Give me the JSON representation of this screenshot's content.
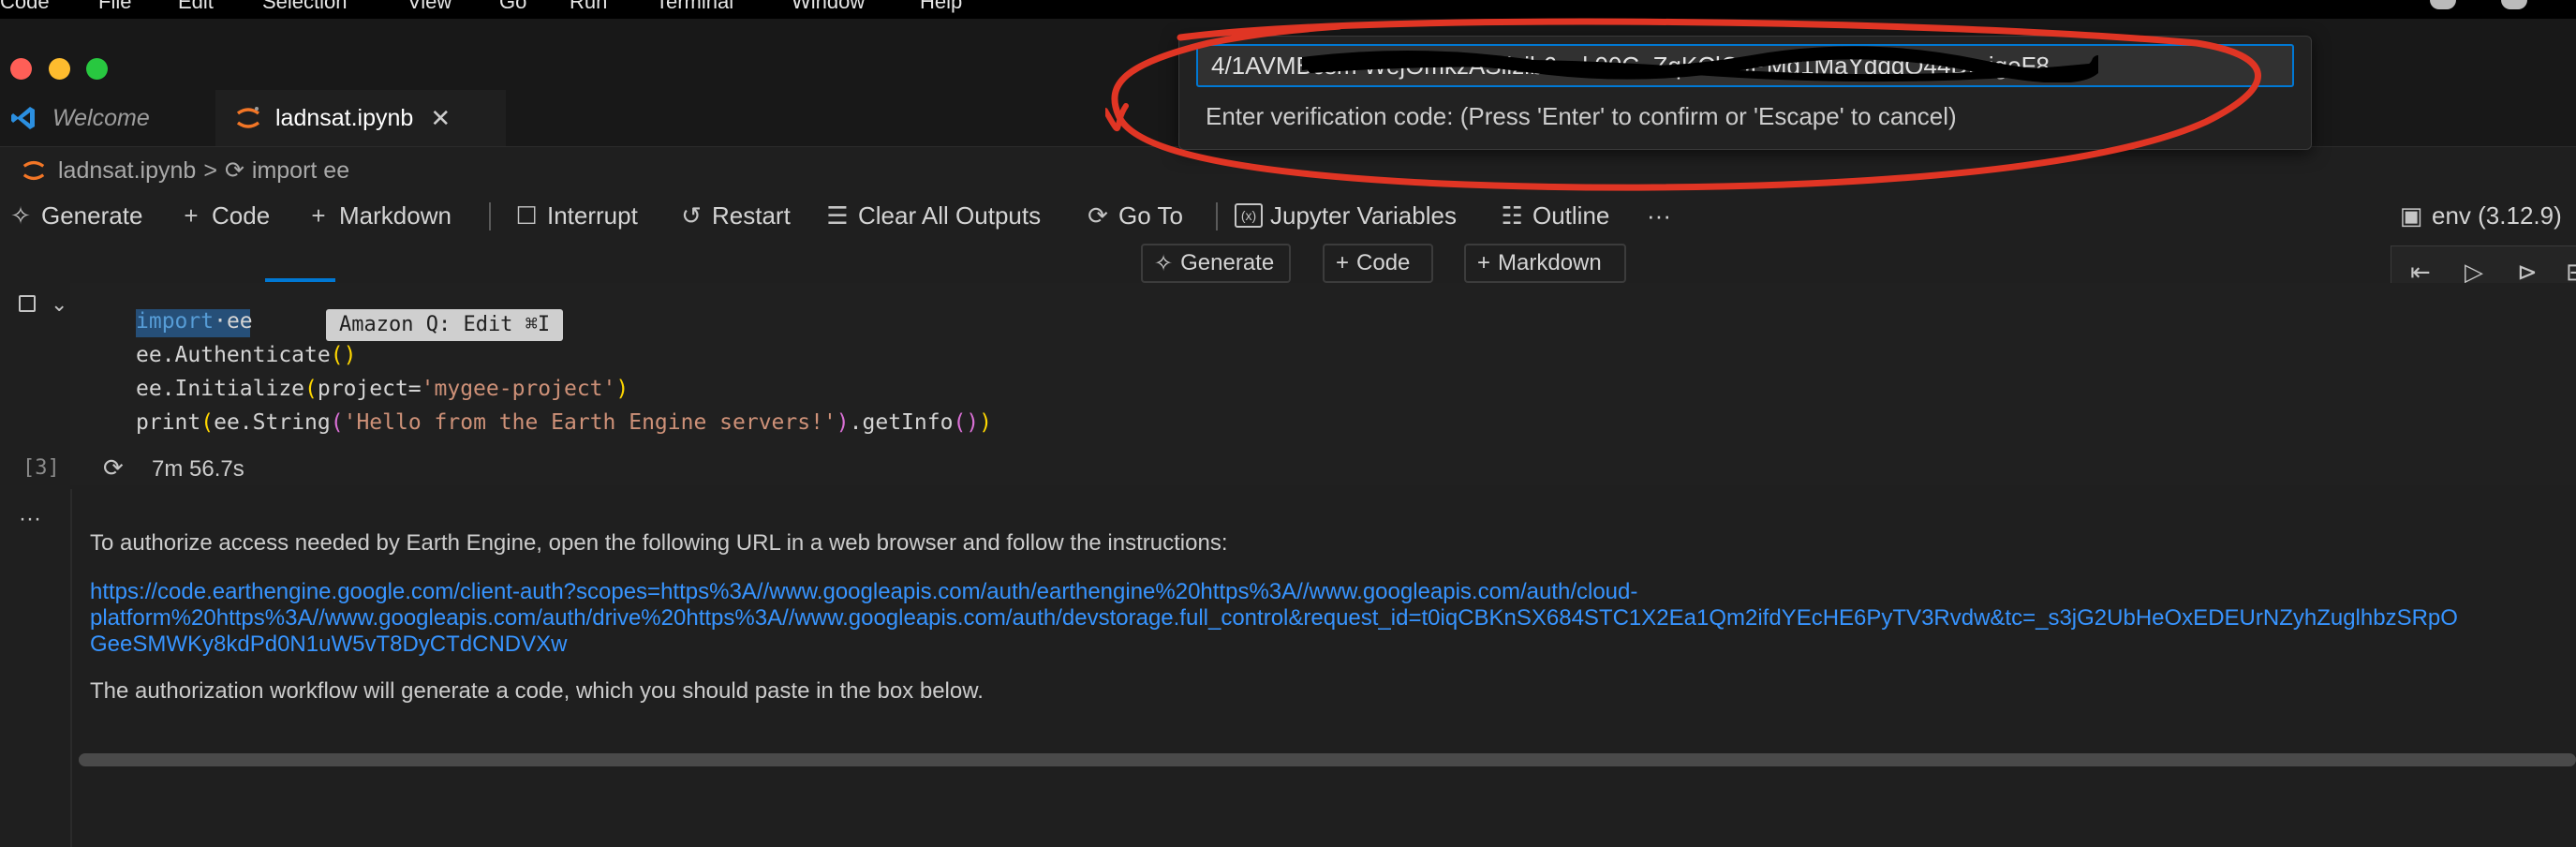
{
  "menubar": {
    "items": [
      "Code",
      "File",
      "Edit",
      "Selection",
      "View",
      "Go",
      "Run",
      "Terminal",
      "Window",
      "Help"
    ]
  },
  "tabs": [
    {
      "label": "Welcome",
      "active": false
    },
    {
      "label": "ladnsat.ipynb",
      "active": true
    }
  ],
  "breadcrumb": {
    "file": "ladnsat.ipynb",
    "separator": ">",
    "symbol": "import ee"
  },
  "toolbar": {
    "generate": "Generate",
    "code": "Code",
    "markdown": "Markdown",
    "interrupt": "Interrupt",
    "restart": "Restart",
    "clear_outputs": "Clear All Outputs",
    "goto": "Go To",
    "jupyter_variables": "Jupyter Variables",
    "outline": "Outline",
    "more": "···",
    "kernel": "env (3.12.9)"
  },
  "insert_bar": {
    "generate": "Generate",
    "code": "Code",
    "markdown": "Markdown"
  },
  "cell": {
    "code_lines": [
      "import ee",
      "ee.Authenticate()",
      "ee.Initialize(project='mygee-project')",
      "print(ee.String('Hello from the Earth Engine servers!').getInfo())"
    ],
    "hint": "Amazon Q: Edit ⌘I",
    "exec_count": "[3]",
    "duration": "7m 56.7s"
  },
  "output": {
    "more": "···",
    "intro": "To authorize access needed by Earth Engine, open the following URL in a web browser and follow the instructions:",
    "url_line1": "https://code.earthengine.google.com/client-auth?scopes=https%3A//www.googleapis.com/auth/earthengine%20https%3A//www.googleapis.com/auth/cloud-",
    "url_line2": "platform%20https%3A//www.googleapis.com/auth/drive%20https%3A//www.googleapis.com/auth/devstorage.full_control&request_id=t0iqCBKnSX684STC1X2Ea1Qm2ifdYEcHE6PyTV3Rvdw&tc=_s3jG2UbHeOxEDEUrNZyhZuglhbzSRpO",
    "url_line3": "GeeSMWKy8kdPd0N1uW5vT8DyCTdCNDVXw",
    "outro": "The authorization workflow will generate a code, which you should paste in the box below."
  },
  "quick_input": {
    "value": "4/1AVMBcsm WejOmkzASiizib6sul 00C_ZqKClCJPMd1MaYdqgO44DmigoF8",
    "message": "Enter verification code: (Press 'Enter' to confirm or 'Escape' to cancel)"
  },
  "colors": {
    "accent": "#0078d4",
    "annotation": "#e03524",
    "link": "#3794ff"
  }
}
